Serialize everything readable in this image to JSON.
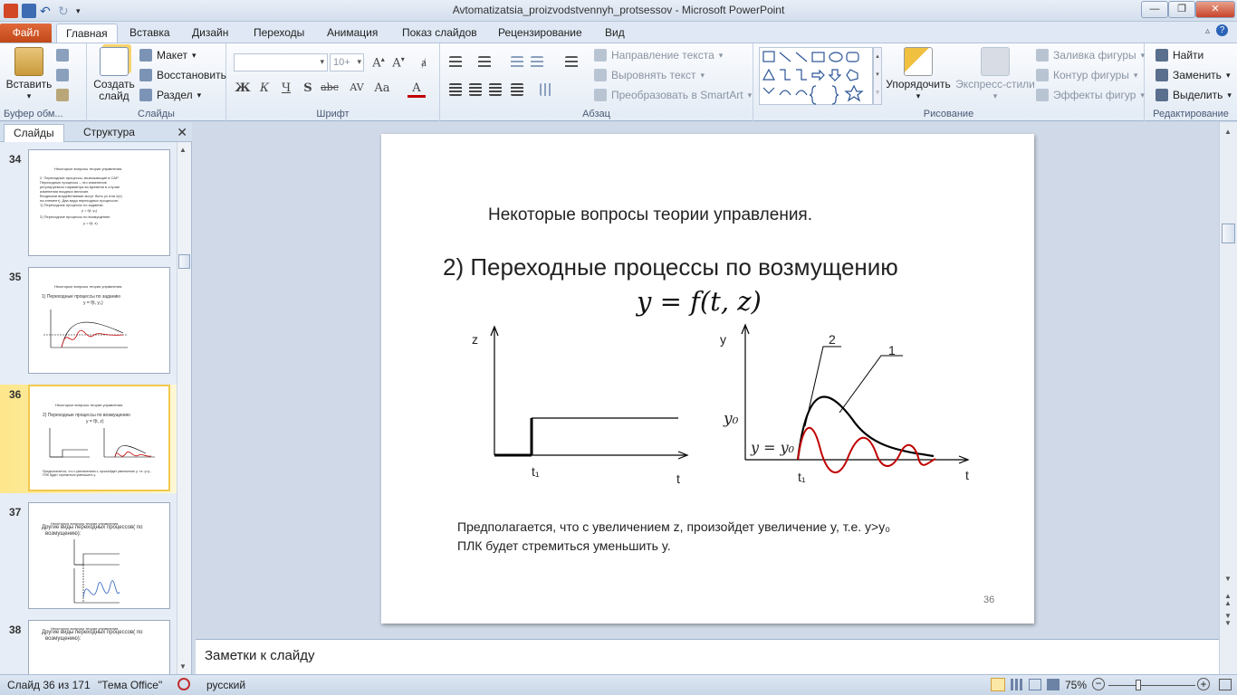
{
  "window": {
    "title": "Avtomatizatsia_proizvodstvennyh_protsessov  -  Microsoft PowerPoint",
    "minimize": "—",
    "restore": "❐",
    "close": "✕"
  },
  "tabs": [
    "Файл",
    "Главная",
    "Вставка",
    "Дизайн",
    "Переходы",
    "Анимация",
    "Показ слайдов",
    "Рецензирование",
    "Вид"
  ],
  "ribbon": {
    "clipboard": {
      "paste": "Вставить",
      "label": "Буфер обм..."
    },
    "slides": {
      "create": "Создать",
      "create2": "слайд",
      "layout": "Макет",
      "reset": "Восстановить",
      "section": "Раздел",
      "label": "Слайды"
    },
    "font": {
      "size": "10+",
      "label": "Шрифт",
      "bold": "Ж",
      "italic": "К",
      "underline": "Ч",
      "shadow": "S",
      "strike": "abc",
      "spacing": "AV",
      "case": "Aa",
      "color": "A"
    },
    "paragraph": {
      "text_direction": "Направление текста",
      "align_text": "Выровнять текст",
      "smartart": "Преобразовать в SmartArt",
      "label": "Абзац"
    },
    "drawing": {
      "arrange": "Упорядочить",
      "quick_styles": "Экспресс-стили",
      "fill": "Заливка фигуры",
      "outline": "Контур фигуры",
      "effects": "Эффекты фигур",
      "label": "Рисование"
    },
    "editing": {
      "find": "Найти",
      "replace": "Заменить",
      "select": "Выделить",
      "label": "Редактирование"
    }
  },
  "panel": {
    "tab_slides": "Слайды",
    "tab_outline": "Структура",
    "close": "✕"
  },
  "thumbnails": [
    {
      "num": "34",
      "title": "Некоторые вопросы теории управления.",
      "lines": [
        "2.  Переходные процессы, возникающие в САР",
        "Переходные процессы – это изменение",
        "регулируемого параметра во времени в случае",
        "изменения входных величин.",
        "Входными воздействиями могут быть ух или z(x)",
        "на элемент). Два вида переходных процессов:",
        "1)  Переходные процессы по заданию",
        "y = f(t; y₀)",
        "2)  Переходные процессы по возмущению",
        "y = f(t, z)"
      ]
    },
    {
      "num": "35",
      "title": "Некоторые вопросы теории управления.",
      "lines": [
        "1) Переходные процессы по заданию",
        "y = f(t, y₀)"
      ]
    },
    {
      "num": "36",
      "title": "Некоторые вопросы теории управления.",
      "lines": [
        "2) Переходные процессы по возмущению",
        "y = f(t, z)",
        "Предполагается, что с увеличением z, произойдет увеличение y, т.е. y>y₀",
        "ПЛК будет стремиться уменьшить y."
      ]
    },
    {
      "num": "37",
      "title": "Некоторые вопросы теории управления.",
      "lines": [
        "Другие виды переходных процессов( по",
        "возмущению):"
      ]
    },
    {
      "num": "38",
      "title": "Некоторые вопросы теории управления.",
      "lines": [
        "Другие виды переходных процессов( по",
        "возмущению):"
      ]
    }
  ],
  "slide": {
    "header": "Некоторые вопросы теории управления.",
    "subtitle": "2)  Переходные процессы по возмущению",
    "formula": "y = f(t, z)",
    "left_chart": {
      "y_label": "z",
      "x_label": "t",
      "t_label": "t₁"
    },
    "right_chart": {
      "y_label": "y",
      "x_label": "t",
      "t_label": "t₁",
      "y0_label": "y₀",
      "eq_label": "y = y₀",
      "curve1": "1",
      "curve2": "2"
    },
    "body_line1": "Предполагается, что с увеличением z, произойдет увеличение y, т.е. y>y₀",
    "body_line2": "ПЛК будет стремиться уменьшить y.",
    "page_number": "36"
  },
  "notes_placeholder": "Заметки к слайду",
  "status": {
    "slide_counter": "Слайд 36 из 171",
    "theme": "\"Тема Office\"",
    "language": "русский",
    "zoom": "75%"
  },
  "colors": {
    "file_tab": "#d05a25",
    "red_curve": "#c00000",
    "selection": "#f2c94c"
  }
}
